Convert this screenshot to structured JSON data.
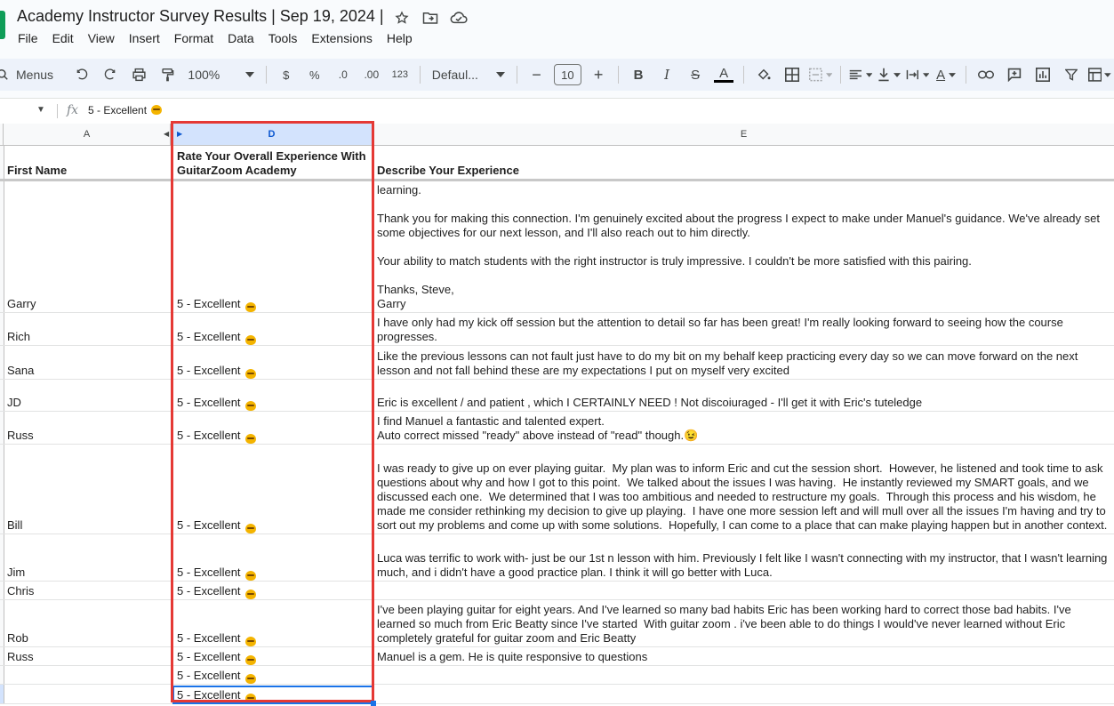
{
  "document": {
    "title": "Academy Instructor Survey Results | Sep 19, 2024 |"
  },
  "menubar": [
    "File",
    "Edit",
    "View",
    "Insert",
    "Format",
    "Data",
    "Tools",
    "Extensions",
    "Help"
  ],
  "toolbar": {
    "search_label": "Menus",
    "zoom": "100%",
    "currency": "$",
    "percent": "%",
    "decrease_decimal": ".0",
    "increase_decimal": ".00",
    "number_format": "123",
    "font": "Defaul...",
    "font_size": "10",
    "bold": "B",
    "italic": "I",
    "strike": "S",
    "text_color": "A"
  },
  "formula_bar": {
    "fx": "fx",
    "content": "5 - Excellent"
  },
  "columns": [
    {
      "letter": "A",
      "selected": false
    },
    {
      "letter": "D",
      "selected": true
    },
    {
      "letter": "E",
      "selected": false
    }
  ],
  "header": {
    "col_a": "First Name",
    "col_d": "Rate Your Overall Experience With GuitarZoom Academy",
    "col_e": "Describe Your Experience"
  },
  "rows": [
    {
      "name": "Garry",
      "rating": "5 - Excellent",
      "experience": "learning.\n\nThank you for making this connection. I'm genuinely excited about the progress I expect to make under Manuel's guidance. We've already set some objectives for our next lesson, and I'll also reach out to him directly.\n\nYour ability to match students with the right instructor is truly impressive. I couldn't be more satisfied with this pairing.\n\nThanks, Steve,\nGarry"
    },
    {
      "name": "Rich",
      "rating": "5 - Excellent",
      "experience": "I have only had my kick off session but the attention to detail so far has been great! I'm really looking forward to seeing how the course progresses."
    },
    {
      "name": "Sana",
      "rating": "5 - Excellent",
      "experience": "Like the previous lessons can not fault just have to do my bit on my behalf keep practicing every day so we can move forward on the next lesson and not fall behind these are my expectations I put on myself very excited"
    },
    {
      "name": "JD",
      "rating": "5 - Excellent",
      "experience": "Eric is excellent / and patient , which I CERTAINLY NEED ! Not discoiuraged - I'll get it with Eric's tuteledge"
    },
    {
      "name": "Russ",
      "rating": "5 - Excellent",
      "experience": "I find Manuel a fantastic and talented expert.\nAuto correct missed \"ready\" above instead of \"read\" though.😉"
    },
    {
      "name": "Bill",
      "rating": "5 - Excellent",
      "experience": "I was ready to give up on ever playing guitar.  My plan was to inform Eric and cut the session short.  However, he listened and took time to ask questions about why and how I got to this point.  We talked about the issues I was having.  He instantly reviewed my SMART goals, and we discussed each one.  We determined that I was too ambitious and needed to restructure my goals.  Through this process and his wisdom, he made me consider rethinking my decision to give up playing.  I have one more session left and will mull over all the issues I'm having and try to sort out my problems and come up with some solutions.  Hopefully, I can come to a place that can make playing happen but in another context."
    },
    {
      "name": "Jim",
      "rating": "5 - Excellent",
      "experience": "Luca was terrific to work with- just be our 1st n lesson with him. Previously I felt like I wasn't connecting with my instructor, that I wasn't learning much, and i didn't have a good practice plan. I think it will go better with Luca."
    },
    {
      "name": "Chris",
      "rating": "5 - Excellent",
      "experience": ""
    },
    {
      "name": "Rob",
      "rating": "5 - Excellent",
      "experience": "I've been playing guitar for eight years. And I've learned so many bad habits Eric has been working hard to correct those bad habits. I've learned so much from Eric Beatty since I've started  With guitar zoom . i've been able to do things I would've never learned without Eric completely grateful for guitar zoom and Eric Beatty"
    },
    {
      "name": "Russ",
      "rating": "5 - Excellent",
      "experience": "Manuel is a gem. He is quite responsive to questions"
    },
    {
      "name": "",
      "rating": "5 - Excellent",
      "experience": ""
    },
    {
      "name": "",
      "rating": "5 - Excellent",
      "experience": ""
    }
  ]
}
